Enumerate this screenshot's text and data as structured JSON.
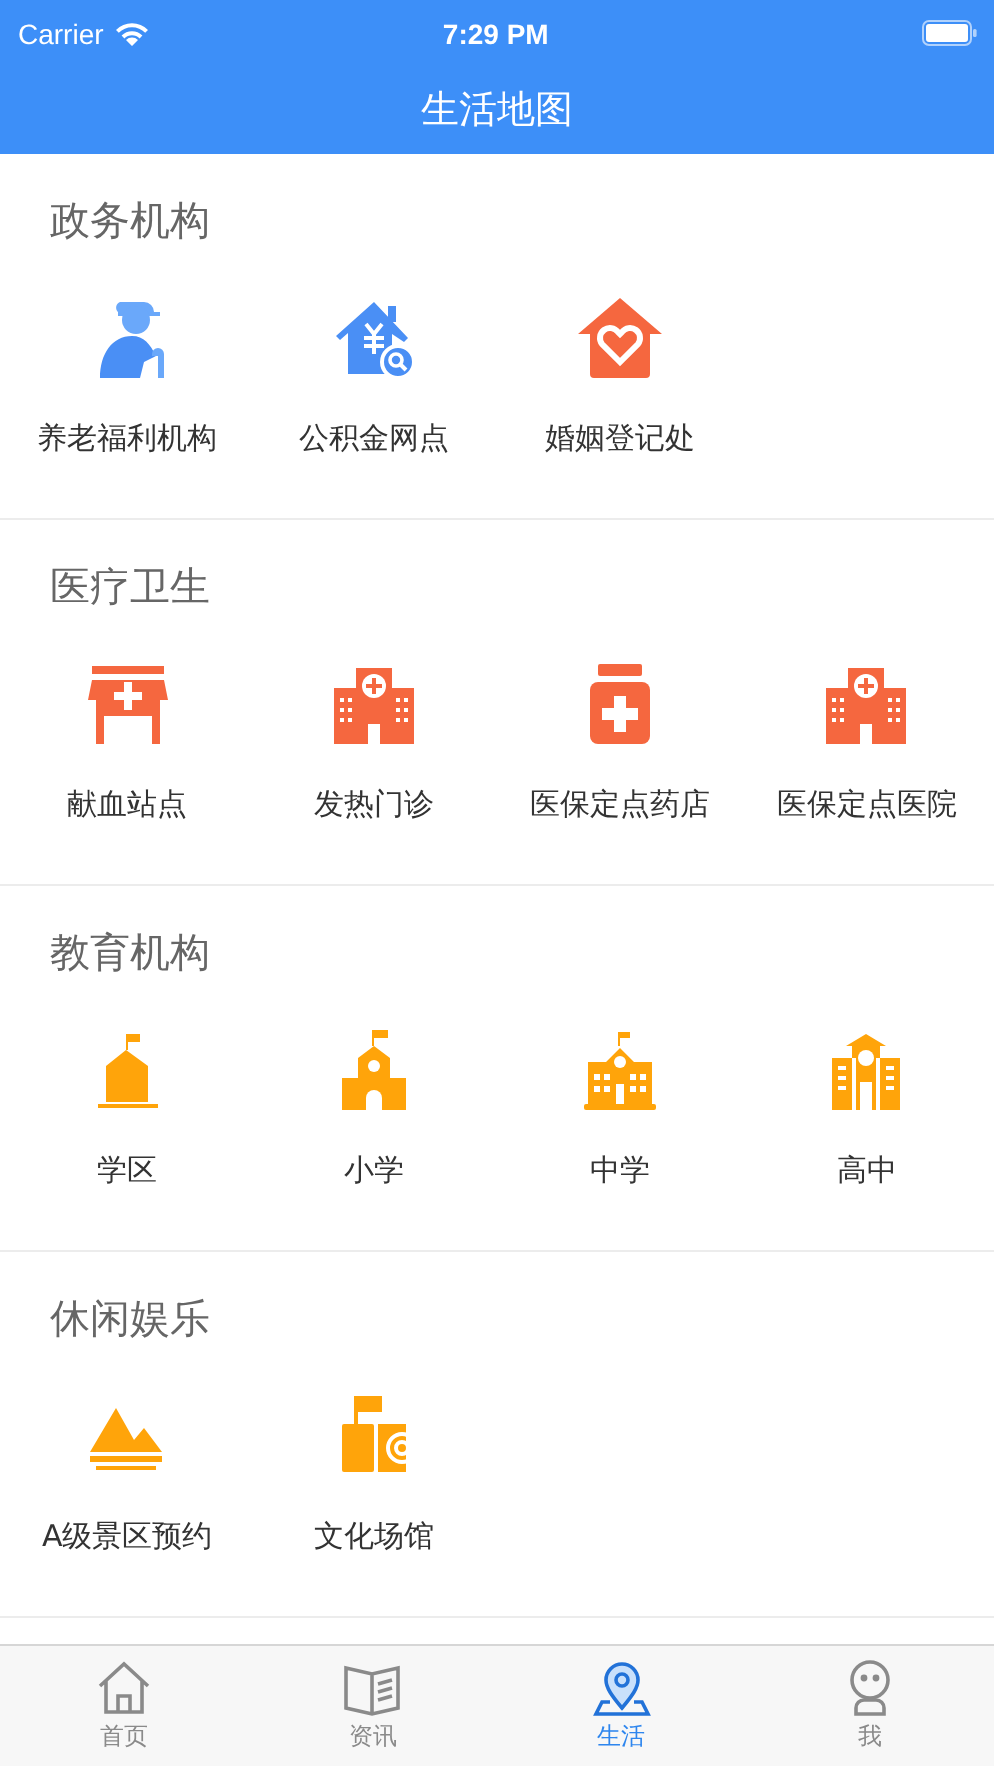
{
  "status_bar": {
    "carrier": "Carrier",
    "time": "7:29 PM"
  },
  "nav": {
    "title": "生活地图"
  },
  "sections": [
    {
      "title": "政务机构",
      "items": [
        {
          "label": "养老福利机构",
          "kind": "elder"
        },
        {
          "label": "公积金网点",
          "kind": "fund"
        },
        {
          "label": "婚姻登记处",
          "kind": "marriage"
        }
      ]
    },
    {
      "title": "医疗卫生",
      "items": [
        {
          "label": "献血站点",
          "kind": "clinic"
        },
        {
          "label": "发热门诊",
          "kind": "hospital"
        },
        {
          "label": "医保定点药店",
          "kind": "pharmacy"
        },
        {
          "label": "医保定点医院",
          "kind": "hospital"
        }
      ]
    },
    {
      "title": "教育机构",
      "items": [
        {
          "label": "学区",
          "kind": "district"
        },
        {
          "label": "小学",
          "kind": "primary"
        },
        {
          "label": "中学",
          "kind": "middle"
        },
        {
          "label": "高中",
          "kind": "high"
        }
      ]
    },
    {
      "title": "休闲娱乐",
      "items": [
        {
          "label": "A级景区预约",
          "kind": "scenic"
        },
        {
          "label": "文化场馆",
          "kind": "venue"
        }
      ]
    }
  ],
  "tabs": [
    {
      "label": "首页",
      "kind": "home",
      "selected": false
    },
    {
      "label": "资讯",
      "kind": "news",
      "selected": false
    },
    {
      "label": "生活",
      "kind": "map",
      "selected": true
    },
    {
      "label": "我",
      "kind": "me",
      "selected": false
    }
  ]
}
